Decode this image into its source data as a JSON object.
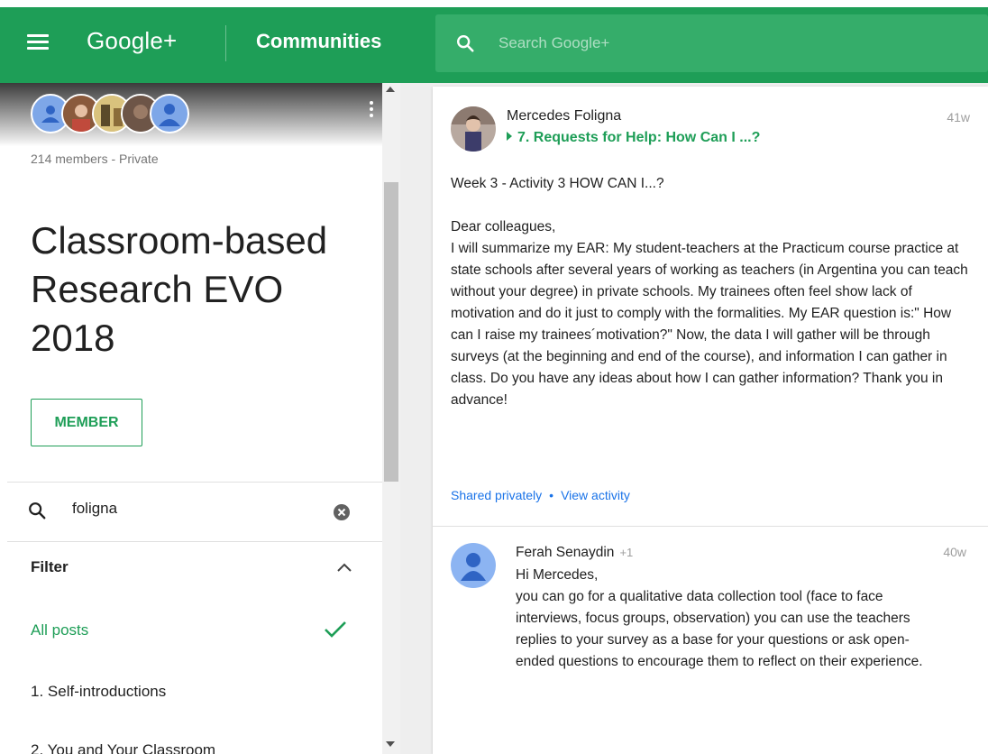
{
  "header": {
    "brand": "Google+",
    "section": "Communities",
    "search_placeholder": "Search Google+"
  },
  "community": {
    "members_text": "214 members - Private",
    "name": "Classroom-based Research EVO 2018",
    "member_button": "MEMBER",
    "search_value": "foligna",
    "filter_label": "Filter",
    "categories": [
      {
        "label": "All posts",
        "active": true
      },
      {
        "label": "1. Self-introductions",
        "active": false
      },
      {
        "label": "2. You and Your Classroom",
        "active": false
      }
    ]
  },
  "post": {
    "author": "Mercedes Foligna",
    "category": "7. Requests for Help: How Can I ...?",
    "time": "41w",
    "title_line": "Week 3 - Activity 3 HOW CAN I...?",
    "greeting": "Dear colleagues,",
    "body": "I will summarize my EAR: My student-teachers at the Practicum course practice at state schools after several years of working as teachers (in Argentina you can teach without your degree) in private schools. My trainees often feel show lack of motivation and do it just to comply with the formalities. My EAR question is:\" How can I raise my trainees´motivation?\"  Now, the data I will gather will be through surveys (at the beginning and end of the course), and information I can gather in class. Do you have any ideas about how I can gather information? Thank you in advance!",
    "shared": "Shared privately",
    "separator": "•",
    "view_activity": "View activity"
  },
  "comment": {
    "author": "Ferah Senaydin",
    "plus": "+1",
    "time": "40w",
    "greeting": "Hi Mercedes,",
    "body": "you can go for a qualitative data collection tool (face to face interviews, focus groups, observation) you can use the teachers replies to your survey as a base for your questions or ask open-ended questions to encourage them to reflect on their experience."
  },
  "colors": {
    "brand_green": "#1e9e57",
    "link_blue": "#1a73e8"
  }
}
